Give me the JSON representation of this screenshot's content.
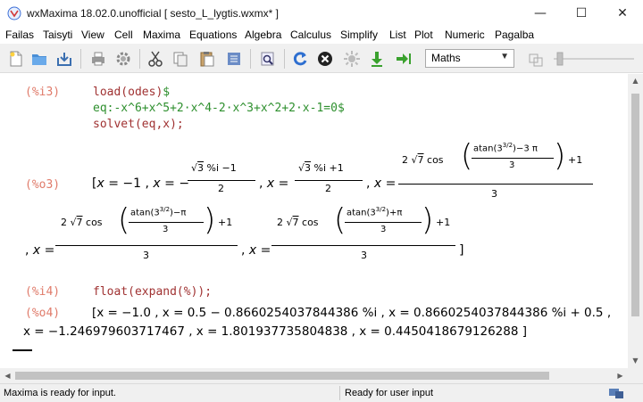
{
  "window": {
    "title": "wxMaxima 18.02.0.unofficial  [ sesto_L_lygtis.wxmx* ]",
    "minimize": "—",
    "maximize": "☐",
    "close": "✕"
  },
  "menu": [
    "Failas",
    "Taisyti",
    "View",
    "Cell",
    "Maxima",
    "Equations",
    "Algebra",
    "Calculus",
    "Simplify",
    "List",
    "Plot",
    "Numeric",
    "Pagalba"
  ],
  "toolbar": {
    "icons": [
      "new-file-icon",
      "open-folder-icon",
      "save-icon",
      "print-icon",
      "settings-icon",
      "cut-icon",
      "copy-icon",
      "paste-icon",
      "select-all-icon",
      "find-icon",
      "refresh-icon",
      "stop-icon",
      "interrupt-icon",
      "step-down-icon",
      "run-to-end-icon"
    ],
    "mode_select": "Maths"
  },
  "cells": {
    "i3": {
      "label": "(%i3)",
      "line1_fn": "load(odes)",
      "line1_end": "$",
      "line2_fn": "eq:-x^6+x^5+2·x^4-2·x^3+x^2+2·x-1=0",
      "line2_end": "$",
      "line3_fn": "solvet(eq,x);"
    },
    "o3": {
      "label": "(%o3)",
      "open": "[",
      "x_eq": "x",
      "eq": "=",
      "minus1": "−1",
      "comma": ",",
      "minus": "−",
      "sqrt3": "3",
      "sqrt7": "7",
      "pct_i": "%i",
      "m1": "−1",
      "p1": "+1",
      "two": "2",
      "three": "3",
      "cos": "cos",
      "atan_a": "atan(3",
      "exp": "3/2",
      "atan_b_1": ")−3 π",
      "atan_b_2": ")−π",
      "atan_b_3": ")+π",
      "close": "]"
    },
    "i4": {
      "label": "(%i4)",
      "code": "float(expand(%));"
    },
    "o4": {
      "label": "(%o4)",
      "line1": "[x = −1.0 , x = 0.5 − 0.8660254037844386 %i , x = 0.8660254037844386 %i + 0.5 ,",
      "line2": "x = −1.246979603717467 , x = 1.801937735804838 , x = 0.4450418679126288 ]"
    }
  },
  "status": {
    "left": "Maxima is ready for input.",
    "right": "Ready for user input"
  }
}
